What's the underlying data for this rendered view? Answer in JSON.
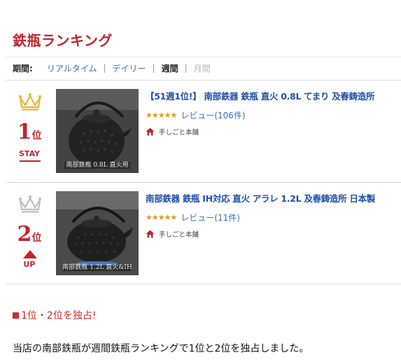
{
  "page": {
    "title": "鉄瓶ランキング",
    "period": {
      "label": "期間:",
      "options": [
        {
          "label": "リアルタイム",
          "state": "link"
        },
        {
          "label": "デイリー",
          "state": "link"
        },
        {
          "label": "週間",
          "state": "active"
        },
        {
          "label": "月間",
          "state": "disabled"
        }
      ],
      "separator": "|"
    }
  },
  "rankings": [
    {
      "rank": "1",
      "rank_unit": "位",
      "crown_color": "#e8b72c",
      "status": "STAY",
      "status_icon": "stay-underline",
      "image_caption": "南部鉄瓶 0.8L 直火用",
      "product_name": "【51週1位!】 南部鉄器 鉄瓶 直火 0.8L てまり 及春鋳造所",
      "stars": "★★★★★",
      "rating": 4.5,
      "review_text": "レビュー(106件)",
      "shop_icon": "home-icon",
      "shop_name": "手しごと本舗"
    },
    {
      "rank": "2",
      "rank_unit": "位",
      "crown_color": "#b7c0cc",
      "status": "UP",
      "status_icon": "up-arrow-icon",
      "image_caption": "南部鉄瓶 1.2L 直火&IH",
      "product_name": "南部鉄器 鉄瓶 IH対応 直火 アラレ 1.2L 及春鋳造所 日本製",
      "stars": "★★★★★",
      "rating": 4.5,
      "review_text": "レビュー(11件)",
      "shop_icon": "home-icon",
      "shop_name": "手しごと本舗"
    }
  ],
  "notice": {
    "marker": "square-bullet",
    "text": "1位・2位を独占!"
  },
  "description": "当店の南部鉄瓶が週間鉄瓶ランキングで1位と2位を独占しました。",
  "colors": {
    "accent_red": "#c0262c",
    "link_blue": "#3a6fb5",
    "star_orange": "#e39b16"
  }
}
